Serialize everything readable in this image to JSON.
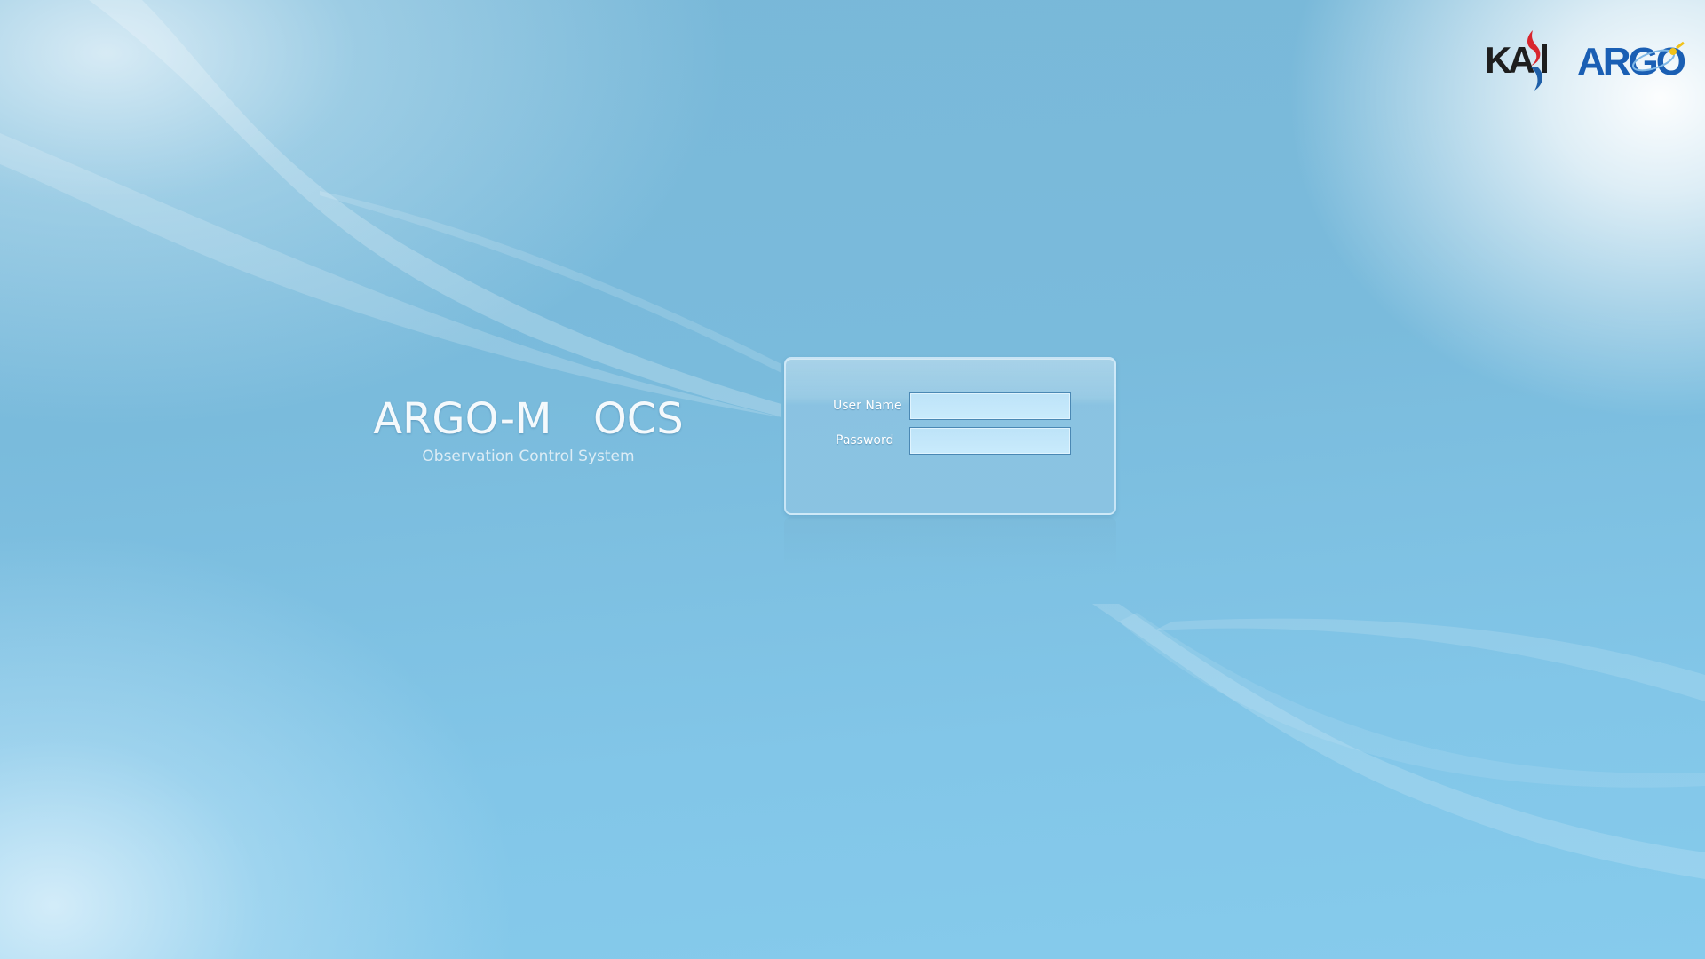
{
  "branding": {
    "app_title": "ARGO-M  OCS",
    "app_subtitle": "Observation Control System",
    "logos": [
      {
        "name": "kasi-logo",
        "text": "KASI"
      },
      {
        "name": "argo-logo",
        "text": "ARGO"
      }
    ]
  },
  "login": {
    "username_label": "User Name",
    "username_value": "",
    "password_label": "Password",
    "password_value": ""
  },
  "colors": {
    "background": "#7abbdc",
    "panel": "#9ccbe4",
    "input_fill": "#c4e7fa",
    "input_border": "#4a88b4",
    "title_text": "#f4f9fc",
    "kasi_red": "#d8262e",
    "kasi_blue": "#1f5fa8",
    "argo_blue": "#1a5fb4",
    "argo_yellow": "#f2c21a"
  }
}
